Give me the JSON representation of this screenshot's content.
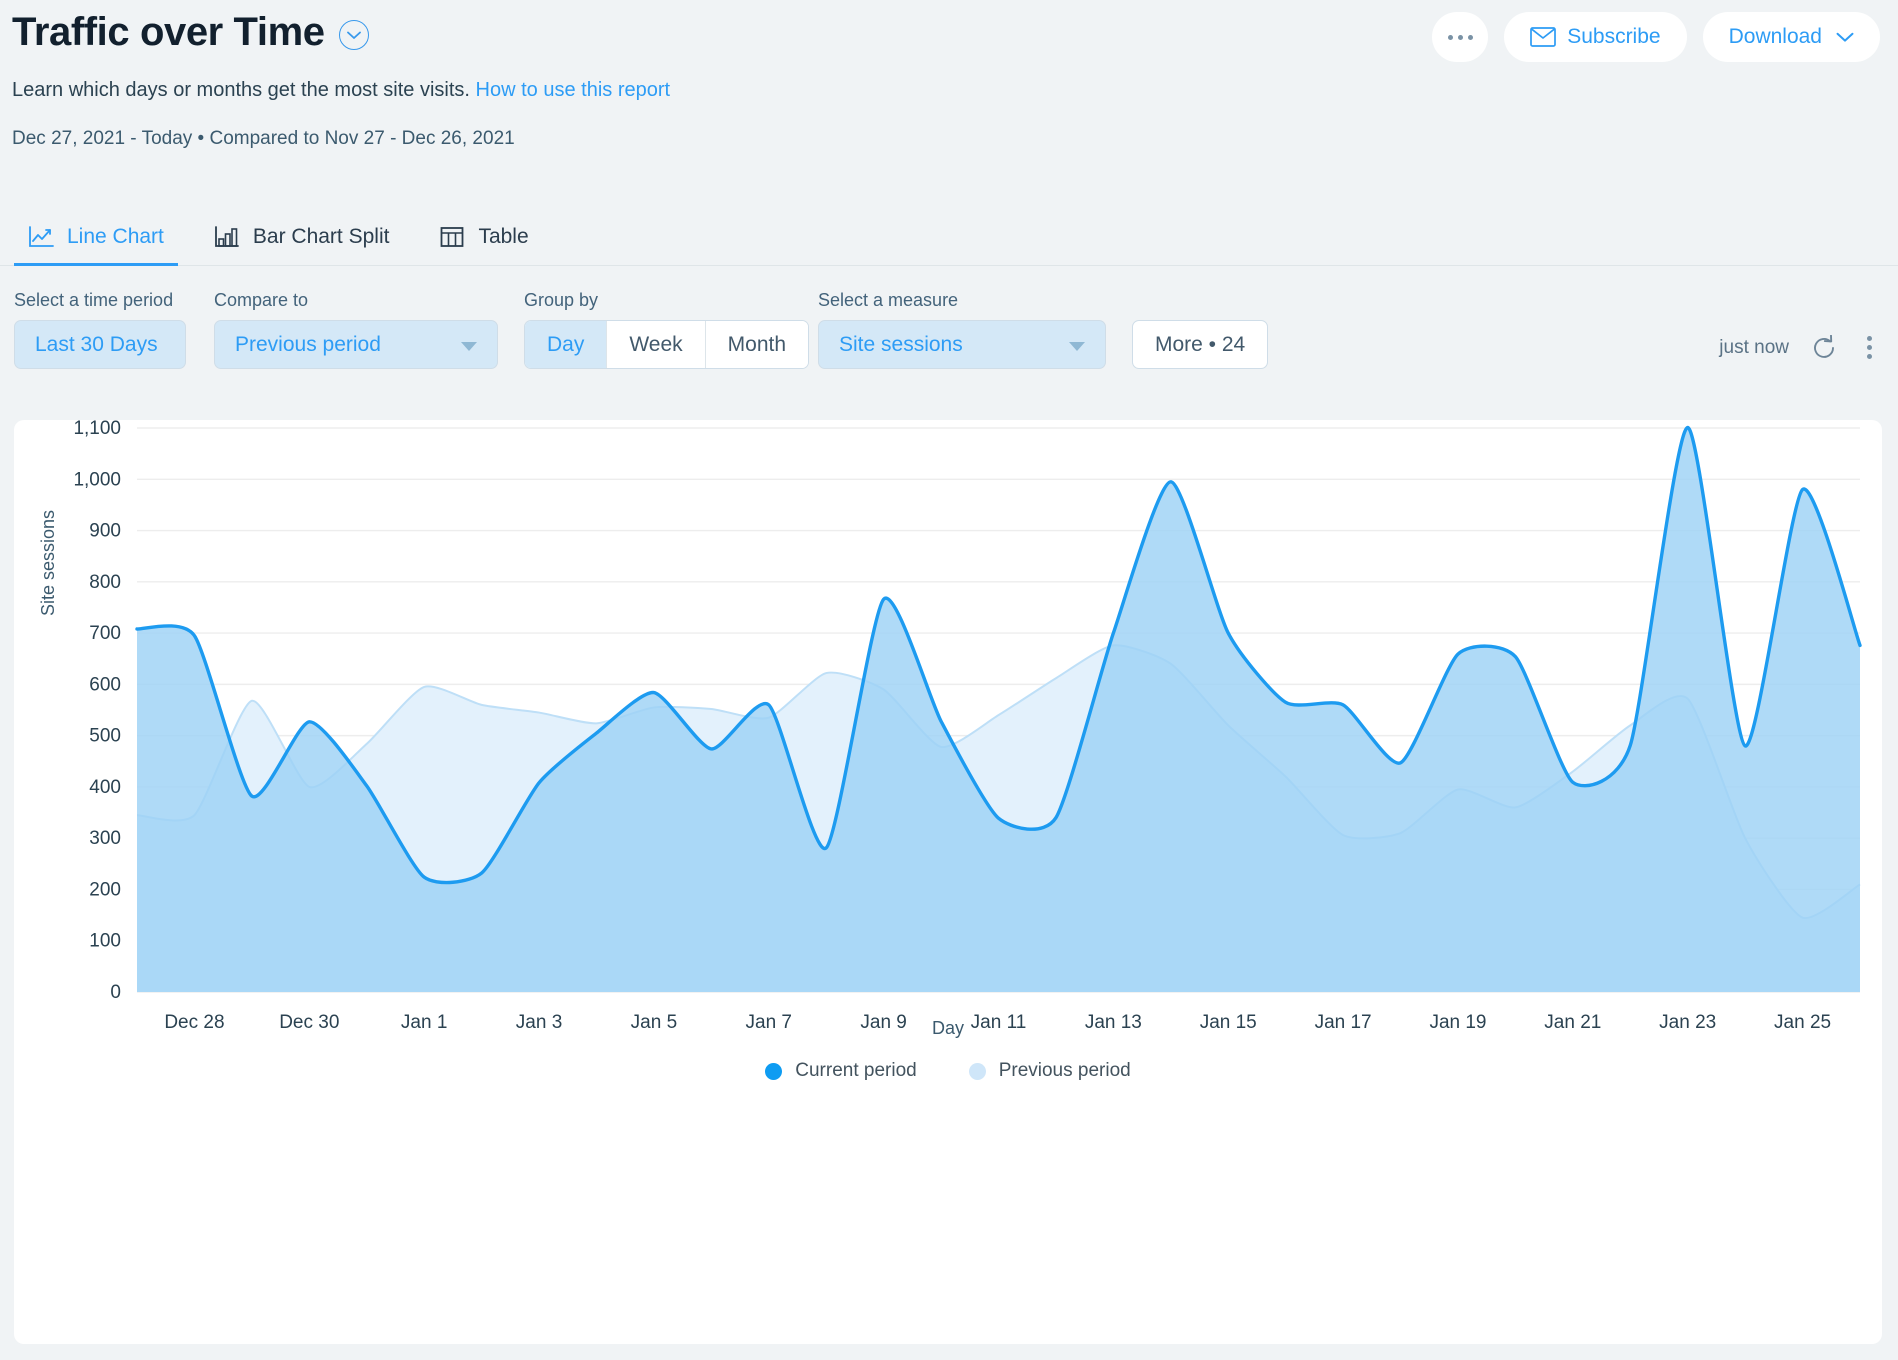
{
  "header": {
    "title": "Traffic over Time",
    "title_caret_icon": "chevron-down-icon",
    "subtitle": "Learn which days or months get the most site visits.",
    "subtitle_link": "How to use this report",
    "date_range": "Dec 27, 2021 - Today  •  Compared to Nov 27 - Dec 26, 2021",
    "more_icon": "ellipsis-icon",
    "subscribe_label": "Subscribe",
    "subscribe_icon": "mail-icon",
    "download_label": "Download",
    "download_caret_icon": "chevron-down-icon"
  },
  "tabs": [
    {
      "label": "Line Chart",
      "icon": "line-chart-icon",
      "active": true
    },
    {
      "label": "Bar Chart Split",
      "icon": "bar-chart-icon",
      "active": false
    },
    {
      "label": "Table",
      "icon": "table-icon",
      "active": false
    }
  ],
  "filters": {
    "time_period": {
      "label": "Select a time period",
      "value": "Last 30 Days"
    },
    "compare_to": {
      "label": "Compare to",
      "value": "Previous period",
      "caret_icon": "caret-down-icon"
    },
    "group_by": {
      "label": "Group by",
      "options": [
        "Day",
        "Week",
        "Month"
      ],
      "selected": "Day"
    },
    "measure": {
      "label": "Select a measure",
      "value": "Site sessions",
      "caret_icon": "caret-down-icon"
    },
    "more": {
      "label": "More • 24"
    },
    "updated": "just now",
    "refresh_icon": "refresh-icon",
    "kebab_icon": "kebab-menu-icon"
  },
  "colors": {
    "accent": "#2d9cf5",
    "current_line": "#1d9bf0",
    "current_fill": "#9ed2f5",
    "previous_fill": "#e3f1fc",
    "gridline": "#ededed",
    "page_bg": "#f0f3f5",
    "card_bg": "#ffffff",
    "title": "#12202e"
  },
  "chart_data": {
    "type": "area",
    "title": "Traffic over Time",
    "xlabel": "Day",
    "ylabel": "Site sessions",
    "ylim": [
      0,
      1100
    ],
    "ytick_labels": [
      "0",
      "100",
      "200",
      "300",
      "400",
      "500",
      "600",
      "700",
      "800",
      "900",
      "1,000",
      "1,100"
    ],
    "yticks": [
      0,
      100,
      200,
      300,
      400,
      500,
      600,
      700,
      800,
      900,
      1000,
      1100
    ],
    "grid": true,
    "legend_position": "bottom",
    "x": [
      "Dec 27",
      "Dec 28",
      "Dec 29",
      "Dec 30",
      "Dec 31",
      "Jan 1",
      "Jan 2",
      "Jan 3",
      "Jan 4",
      "Jan 5",
      "Jan 6",
      "Jan 7",
      "Jan 8",
      "Jan 9",
      "Jan 10",
      "Jan 11",
      "Jan 12",
      "Jan 13",
      "Jan 14",
      "Jan 15",
      "Jan 16",
      "Jan 17",
      "Jan 18",
      "Jan 19",
      "Jan 20",
      "Jan 21",
      "Jan 22",
      "Jan 23",
      "Jan 24",
      "Jan 25"
    ],
    "xtick_labels": [
      "Dec 28",
      "Dec 30",
      "Jan 1",
      "Jan 3",
      "Jan 5",
      "Jan 7",
      "Jan 9",
      "Jan 11",
      "Jan 13",
      "Jan 15",
      "Jan 17",
      "Jan 19",
      "Jan 21",
      "Jan 23",
      "Jan 25"
    ],
    "series": [
      {
        "name": "Current period",
        "color": "#1d9bf0",
        "fill": "#9ed2f5",
        "values": [
          708,
          695,
          382,
          527,
          402,
          224,
          232,
          408,
          505,
          584,
          474,
          560,
          281,
          766,
          528,
          339,
          340,
          700,
          995,
          700,
          565,
          560,
          447,
          659,
          654,
          409,
          481,
          1101,
          480,
          980,
          676
        ]
      },
      {
        "name": "Previous period",
        "color": "#bedff7",
        "fill": "#e3f1fc",
        "values": [
          345,
          345,
          568,
          400,
          484,
          595,
          560,
          545,
          524,
          555,
          552,
          535,
          622,
          590,
          478,
          540,
          612,
          676,
          640,
          520,
          420,
          306,
          310,
          395,
          360,
          430,
          520,
          572,
          300,
          145,
          210
        ]
      }
    ]
  },
  "legend": [
    {
      "label": "Current period",
      "color": "#0e9cf2"
    },
    {
      "label": "Previous period",
      "color": "#cfe6f9"
    }
  ]
}
